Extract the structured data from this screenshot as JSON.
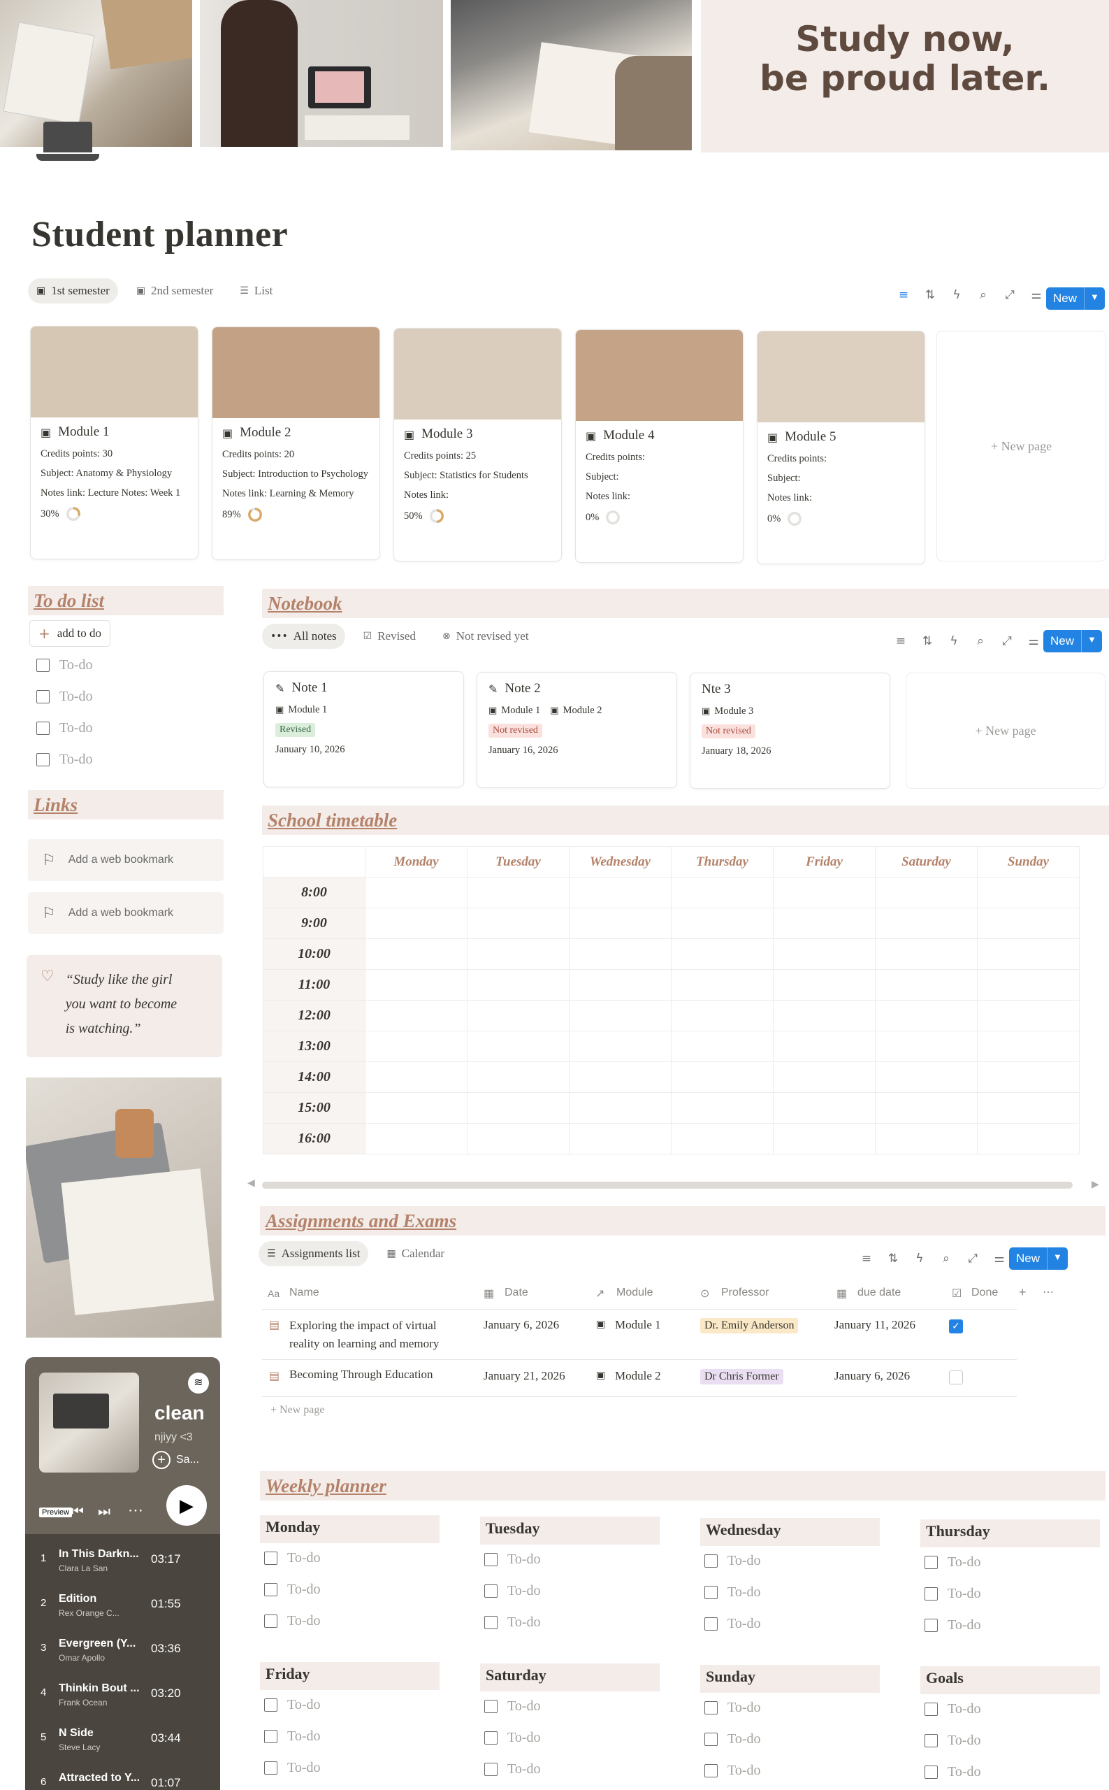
{
  "banner": {
    "quote_line1": "Study now,",
    "quote_line2": "be proud later."
  },
  "page": {
    "title": "Student planner",
    "icon": "laptop-icon"
  },
  "modules_view": {
    "tabs": [
      {
        "label": "1st semester"
      },
      {
        "label": "2nd semester"
      },
      {
        "label": "List"
      }
    ],
    "new_label": "New",
    "new_page_label": "+ New page",
    "cards": [
      {
        "title": "Module 1",
        "credits": "Credits points: 30",
        "subject": "Subject: Anatomy & Physiology",
        "notes": "Notes link: Lecture Notes: Week 1",
        "progress_label": "30%",
        "progress": 0.3,
        "cover": "#d6c7b4"
      },
      {
        "title": "Module 2",
        "credits": "Credits points: 20",
        "subject": "Subject: Introduction to Psychology",
        "notes": "Notes link: Learning & Memory",
        "progress_label": "89%",
        "progress": 0.89,
        "cover": "#c3a184"
      },
      {
        "title": "Module 3",
        "credits": "Credits points: 25",
        "subject": "Subject: Statistics for Students",
        "notes": "Notes link:",
        "progress_label": "50%",
        "progress": 0.5,
        "cover": "#dacdbd"
      },
      {
        "title": "Module 4",
        "credits": "Credits points:",
        "subject": "Subject:",
        "notes": "Notes link:",
        "progress_label": "0%",
        "progress": 0,
        "cover": "#c4a387"
      },
      {
        "title": "Module 5",
        "credits": "Credits points:",
        "subject": "Subject:",
        "notes": "Notes link:",
        "progress_label": "0%",
        "progress": 0,
        "cover": "#ddd0c1"
      }
    ]
  },
  "todo": {
    "heading": "To do list",
    "add_label": "add to do",
    "items": [
      "To-do",
      "To-do",
      "To-do",
      "To-do"
    ]
  },
  "links": {
    "heading": "Links",
    "bookmarks": [
      "Add a web bookmark",
      "Add a web bookmark"
    ]
  },
  "quote": {
    "line1": "“Study like the girl",
    "line2": "you want to become",
    "line3": "is watching.”"
  },
  "player": {
    "title": "clean",
    "subtitle": "njiyy <3",
    "save_label": "Sa...",
    "preview_label": "Preview",
    "tracks": [
      {
        "n": "1",
        "name": "In This Darkn...",
        "artist": "Clara La San",
        "time": "03:17"
      },
      {
        "n": "2",
        "name": "Edition",
        "artist": "Rex Orange C...",
        "time": "01:55"
      },
      {
        "n": "3",
        "name": "Evergreen (Y...",
        "artist": "Omar Apollo",
        "time": "03:36"
      },
      {
        "n": "4",
        "name": "Thinkin Bout ...",
        "artist": "Frank Ocean",
        "time": "03:20"
      },
      {
        "n": "5",
        "name": "N Side",
        "artist": "Steve Lacy",
        "time": "03:44"
      },
      {
        "n": "6",
        "name": "Attracted to Y...",
        "artist": "",
        "time": "01:07"
      }
    ]
  },
  "notebook": {
    "heading": "Notebook",
    "tabs": [
      {
        "label": "All notes"
      },
      {
        "label": "Revised"
      },
      {
        "label": "Not revised yet"
      }
    ],
    "new_label": "New",
    "new_page_label": "+ New page",
    "notes": [
      {
        "title": "Note 1",
        "modules": [
          "Module 1"
        ],
        "status": "Revised",
        "date": "January 10, 2026"
      },
      {
        "title": "Note 2",
        "modules": [
          "Module 1",
          "Module 2"
        ],
        "status": "Not revised",
        "date": "January 16, 2026"
      },
      {
        "title": "Nte 3",
        "modules": [
          "Module 3"
        ],
        "status": "Not revised",
        "date": "January 18, 2026"
      }
    ]
  },
  "timetable": {
    "heading": "School timetable",
    "days": [
      "Monday",
      "Tuesday",
      "Wednesday",
      "Thursday",
      "Friday",
      "Saturday",
      "Sunday"
    ],
    "hours": [
      "8:00",
      "9:00",
      "10:00",
      "11:00",
      "12:00",
      "13:00",
      "14:00",
      "15:00",
      "16:00"
    ]
  },
  "assignments": {
    "heading": "Assignments and Exams",
    "tabs": [
      {
        "label": "Assignments list"
      },
      {
        "label": "Calendar"
      }
    ],
    "new_label": "New",
    "columns": [
      "Name",
      "Date",
      "Module",
      "Professor",
      "due date",
      "Done"
    ],
    "rows": [
      {
        "name1": "Exploring the impact of virtual",
        "name2": "reality on learning and memory",
        "date": "January 6, 2026",
        "module": "Module 1",
        "professor": "Dr. Emily Anderson",
        "due": "January 11, 2026",
        "done": true
      },
      {
        "name1": "Becoming Through Education",
        "name2": "",
        "date": "January 21, 2026",
        "module": "Module 2",
        "professor": "Dr Chris Former",
        "due": "January 6, 2026",
        "done": false
      }
    ],
    "new_page_label": "+ New page"
  },
  "weekly": {
    "heading": "Weekly planner",
    "days": [
      "Monday",
      "Tuesday",
      "Wednesday",
      "Thursday",
      "Friday",
      "Saturday",
      "Sunday",
      "Goals"
    ],
    "item_label": "To-do"
  },
  "colors": {
    "accent": "#2383e2",
    "heading_bg": "#f4ece8",
    "heading_text": "#b4826a"
  }
}
